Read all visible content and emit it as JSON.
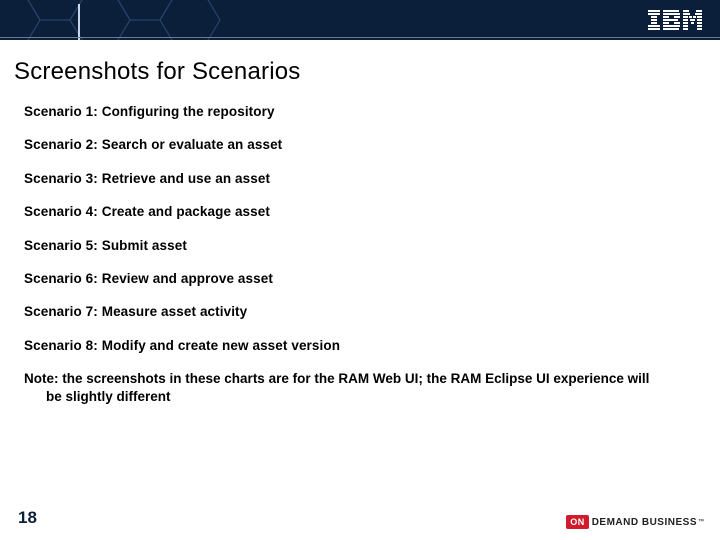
{
  "header": {
    "logo_alt": "IBM"
  },
  "title": "Screenshots for Scenarios",
  "scenarios": [
    "Scenario 1: Configuring the repository",
    "Scenario 2: Search or evaluate an asset",
    "Scenario 3: Retrieve and use an asset",
    "Scenario 4: Create and package asset",
    "Scenario 5: Submit asset",
    "Scenario 6: Review and approve asset",
    "Scenario 7: Measure asset activity",
    "Scenario 8: Modify and create new asset version"
  ],
  "note": "Note: the screenshots in these charts are for the RAM Web UI; the RAM Eclipse UI experience will be slightly different",
  "page_number": "18",
  "footer": {
    "on": "ON",
    "demand": "DEMAND BUSINESS",
    "tm": "™"
  }
}
